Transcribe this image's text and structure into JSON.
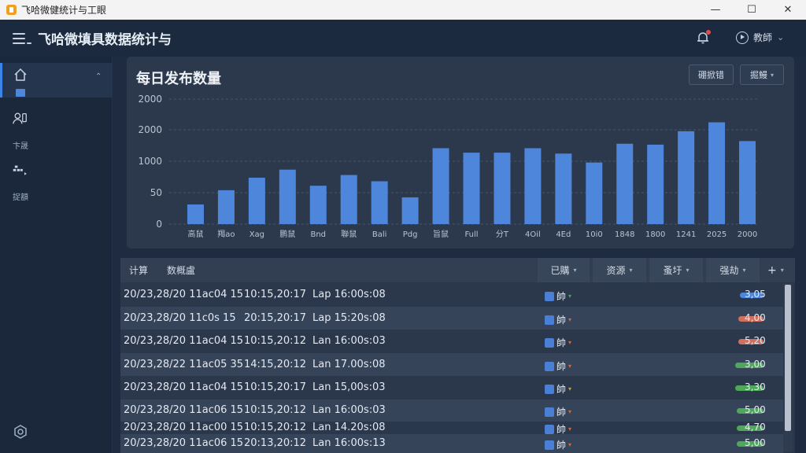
{
  "window": {
    "title": "飞哈微健统计与工眼",
    "controls": [
      "—",
      "☐",
      "✕"
    ]
  },
  "header": {
    "title": "飞哈微填具数据统计与",
    "user_label": "教師"
  },
  "sidebar": {
    "items": [
      {
        "icon": "home-icon",
        "label": ""
      },
      {
        "icon": "users-icon",
        "label": "卞晟"
      },
      {
        "icon": "data-icon",
        "label": "捉額"
      }
    ],
    "footer_icon": "settings-icon"
  },
  "chart": {
    "title": "每日发布数量",
    "buttons": [
      "硼掀错",
      "掘鰻"
    ]
  },
  "chart_data": {
    "type": "bar",
    "title": "每日发布数量",
    "categories": [
      "高鼠",
      "羯ao",
      "Xag",
      "鹏鼠",
      "Bnd",
      "聯鼠",
      "Bali",
      "Pdg",
      "旨鼠",
      "Full",
      "分T",
      "4Oil",
      "4Ed",
      "10i0",
      "1848",
      "1800",
      "1241",
      "2025",
      "2000"
    ],
    "values": [
      2.2,
      3.8,
      5.2,
      6.1,
      4.3,
      5.5,
      4.8,
      3.0,
      8.5,
      8.0,
      8.0,
      8.5,
      7.9,
      6.9,
      9.0,
      8.9,
      10.4,
      11.4,
      9.3
    ],
    "y_ticks": [
      "0",
      "50",
      "1000",
      "2000",
      "2000"
    ],
    "ylim": [
      0,
      14
    ],
    "grid": true,
    "bar_color": "#4e86dc"
  },
  "table": {
    "tabs": [
      "计算",
      "数概盧"
    ],
    "columns": [
      "已購",
      "资源",
      "蚤圩",
      "强劫"
    ],
    "rows": [
      {
        "c1": "20/23,28/20 11ac04 15",
        "c2": "10:15,20:17",
        "c3": "Lap 16:00s:08",
        "tag": "帥",
        "arrow": "▾",
        "arrow_color": "#3bb04a",
        "pill_color": "#4e86dc",
        "value": "3,05"
      },
      {
        "c1": "20/23,28/20 11c0s 15",
        "c2": "20:15,20:17",
        "c3": "Lap 15:20s:08",
        "tag": "帥",
        "arrow": "▾",
        "arrow_color": "#d4683a",
        "pill_color": "#d0705e",
        "value": "4,00"
      },
      {
        "c1": "20/23,28/20 11ac04 15",
        "c2": "10:15,20:12",
        "c3": "Lan 16:00s:03",
        "tag": "帥",
        "arrow": "▾",
        "arrow_color": "#d4683a",
        "pill_color": "#d0705e",
        "value": "5,20"
      },
      {
        "c1": "20/23,28/22 11ac05 35",
        "c2": "14:15,20:12",
        "c3": "Lan 17.00s:08",
        "tag": "帥",
        "arrow": "▾",
        "arrow_color": "#d4683a",
        "pill_color": "#4fa85a",
        "value": "3,00"
      },
      {
        "c1": "20/23,28/20 11ac04 15",
        "c2": "10:15,20:17",
        "c3": "Lan 15,00s:03",
        "tag": "帥",
        "arrow": "▾",
        "arrow_color": "#c9a42c",
        "pill_color": "#4fa85a",
        "value": "3,30"
      },
      {
        "c1": "20/23,28/20 11ac06 15",
        "c2": "10:15,20:12",
        "c3": "Lan 16:00s:03",
        "tag": "帥",
        "arrow": "▾",
        "arrow_color": "#d4683a",
        "pill_color": "#4fa85a",
        "value": "5,00"
      },
      {
        "c1": "20/23,28/20 11ac00 15",
        "c2": "10:15,20:12",
        "c3": "Lan 14.20s:08",
        "tag": "帥",
        "arrow": "▾",
        "arrow_color": "#d4683a",
        "pill_color": "#4fa85a",
        "value": "4,70"
      },
      {
        "c1": "20/23,28/20 11ac06 15",
        "c2": "20:13,20:12",
        "c3": "Lan 16:00s:13",
        "tag": "帥",
        "arrow": "▾",
        "arrow_color": "#d4683a",
        "pill_color": "#4fa85a",
        "value": "5,00"
      }
    ]
  }
}
